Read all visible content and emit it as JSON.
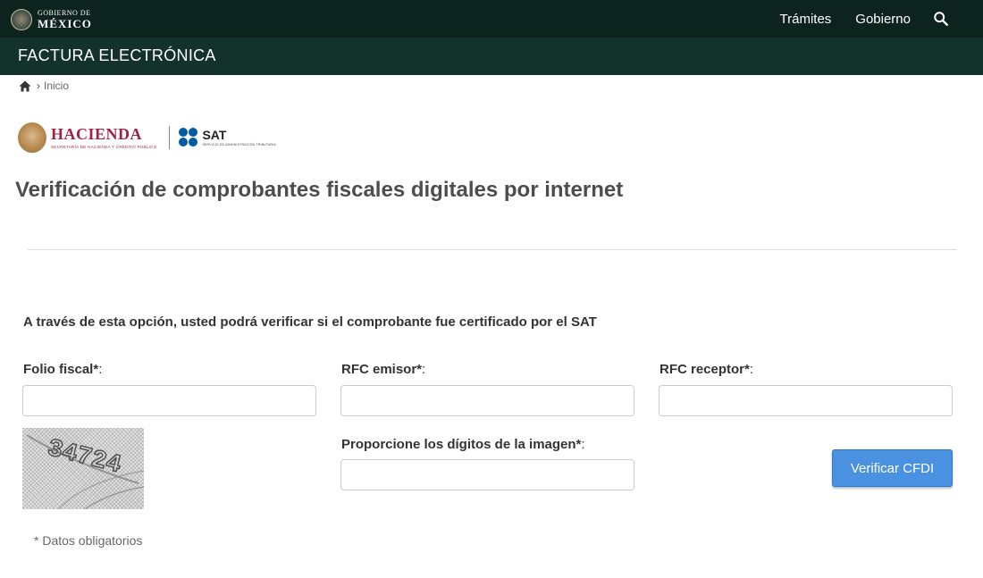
{
  "header": {
    "gov_logo_line1": "GOBIERNO DE",
    "gov_logo_line2": "MÉXICO",
    "nav": [
      "Trámites",
      "Gobierno"
    ],
    "search_icon": "search-icon"
  },
  "subheader": {
    "title": "FACTURA ELECTRÓNICA"
  },
  "breadcrumb": {
    "home_icon": "home-icon",
    "separator": "›",
    "current": "Inicio"
  },
  "logos": {
    "hacienda_name": "HACIENDA",
    "hacienda_sub": "SECRETARÍA DE HACIENDA Y CRÉDITO PÚBLICO",
    "sat_name": "SAT",
    "sat_sub": "SERVICIO DE ADMINISTRACIÓN TRIBUTARIA"
  },
  "page": {
    "title": "Verificación de comprobantes fiscales digitales por internet",
    "intro": "A través de esta opción, usted podrá verificar si el comprobante fue certificado por el SAT"
  },
  "form": {
    "colon": ":",
    "folio_label": "Folio fiscal*",
    "folio_value": "",
    "rfc_emisor_label": "RFC emisor*",
    "rfc_emisor_value": "",
    "rfc_receptor_label": "RFC receptor*",
    "rfc_receptor_value": "",
    "captcha_label": "Proporcione los dígitos de la imagen*",
    "captcha_value": "",
    "captcha_text": "34724",
    "submit_label": "Verificar CFDI",
    "required_note": "* Datos obligatorios"
  },
  "colors": {
    "topbar": "#0c231e",
    "subbar": "#13322b",
    "hacienda": "#9d2449",
    "sat_blue": "#005ba5",
    "button": "#4a91e2"
  }
}
